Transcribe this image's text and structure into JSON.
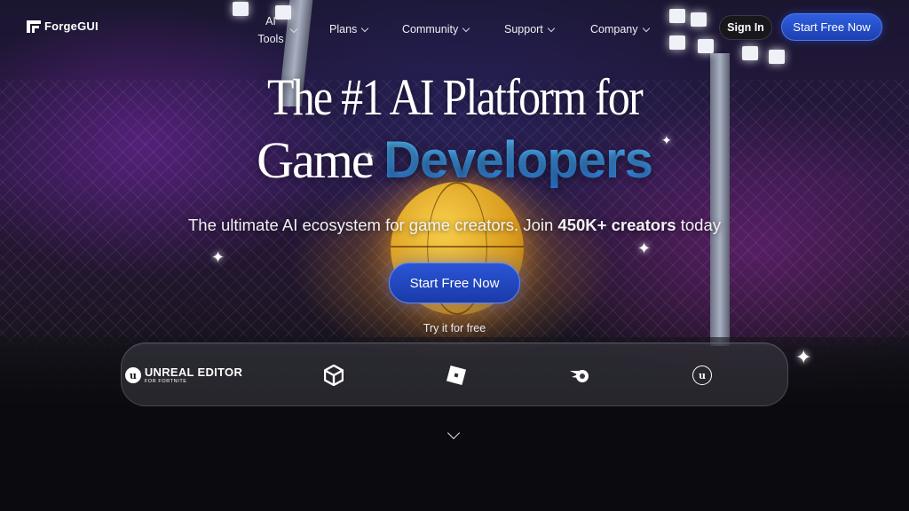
{
  "brand": {
    "name": "ForgeGUI"
  },
  "nav": {
    "items": [
      {
        "label": "AI Tools"
      },
      {
        "label": "Plans"
      },
      {
        "label": "Community"
      },
      {
        "label": "Support"
      },
      {
        "label": "Company"
      }
    ],
    "sign_in": "Sign In",
    "cta": "Start Free Now"
  },
  "hero": {
    "title_line1": "The #1 AI Platform for",
    "title_line2_plain": "Game ",
    "title_line2_accent": "Developers",
    "subtitle_pre": "The ultimate AI ecosystem for game creators. Join ",
    "subtitle_bold": "450K+ creators",
    "subtitle_post": " today",
    "cta": "Start Free Now",
    "try_text": "Try it for free"
  },
  "partners": {
    "unreal_editor_main": "UNREAL EDITOR",
    "unreal_editor_sub": "FOR FORTNITE",
    "unreal_badge": "u",
    "unreal_engine_badge": "u",
    "icons": [
      "unreal-editor-fortnite-logo",
      "unity-logo",
      "roblox-logo",
      "blender-logo",
      "unreal-engine-logo"
    ]
  },
  "colors": {
    "accent": "#3ea8ff",
    "cta_blue": "#2b55d6"
  }
}
